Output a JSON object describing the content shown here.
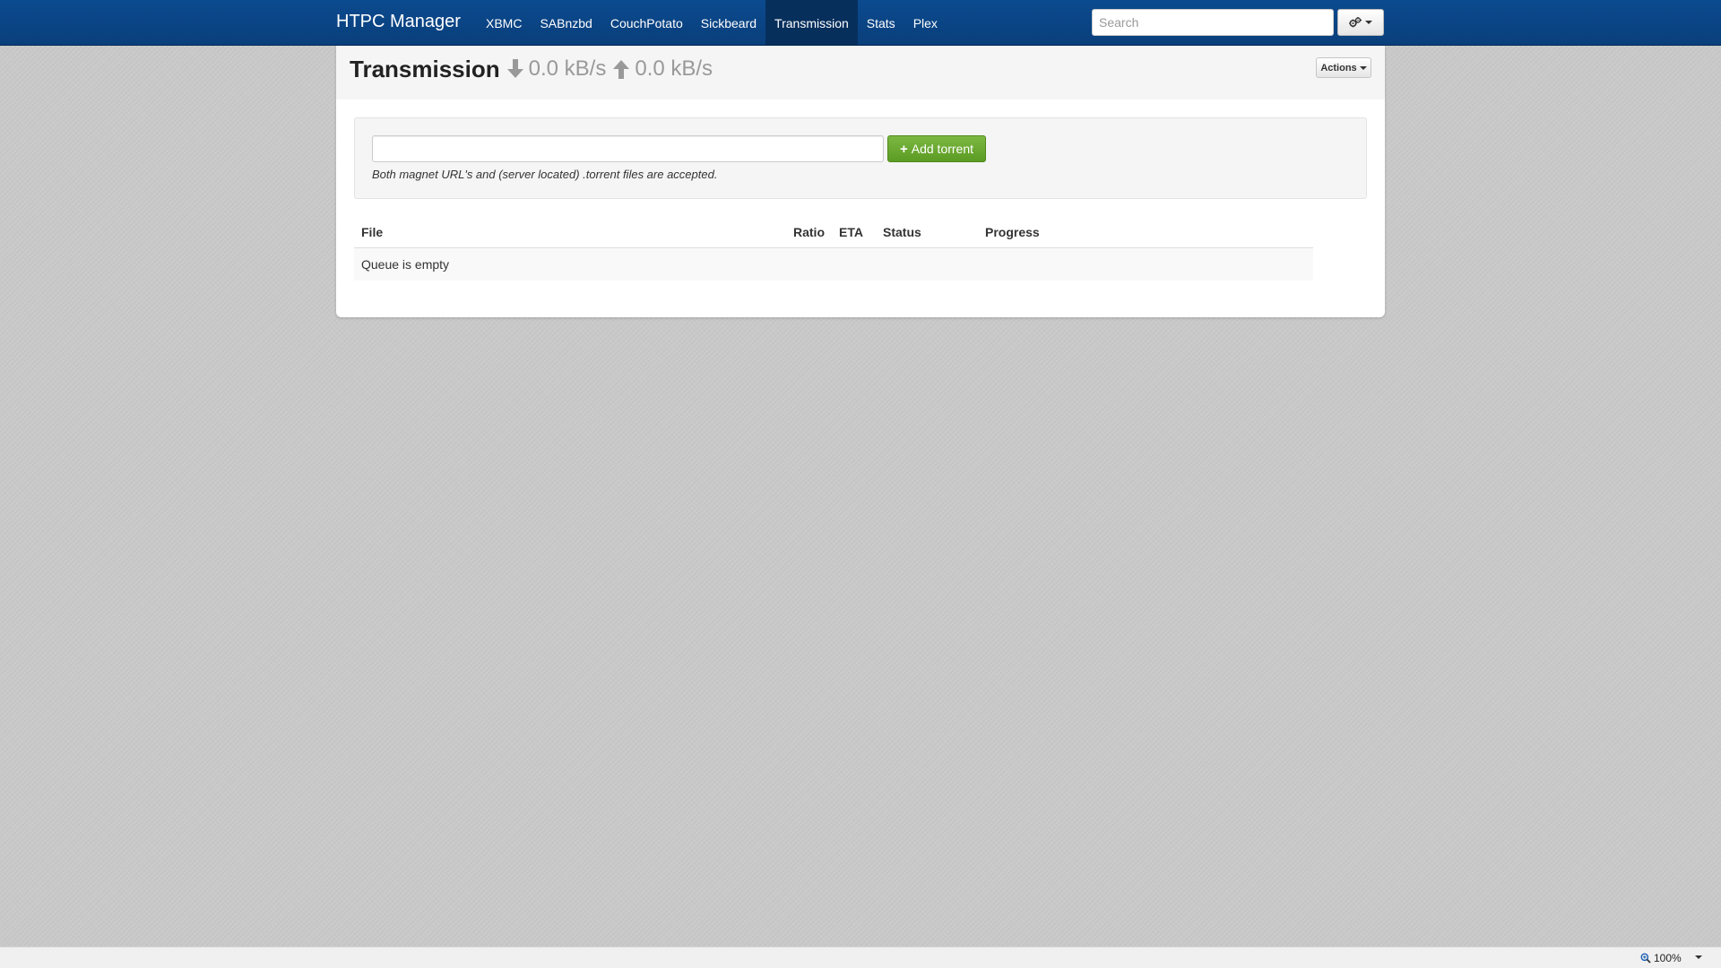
{
  "navbar": {
    "brand": "HTPC Manager",
    "items": [
      {
        "label": "XBMC",
        "active": false
      },
      {
        "label": "SABnzbd",
        "active": false
      },
      {
        "label": "CouchPotato",
        "active": false
      },
      {
        "label": "Sickbeard",
        "active": false
      },
      {
        "label": "Transmission",
        "active": true
      },
      {
        "label": "Stats",
        "active": false
      },
      {
        "label": "Plex",
        "active": false
      }
    ],
    "search_placeholder": "Search",
    "settings_icon": "gears-icon",
    "bg_color": "#0a4282"
  },
  "header": {
    "title": "Transmission",
    "download_speed": "0.0 kB/s",
    "upload_speed": "0.0 kB/s",
    "actions_label": "Actions"
  },
  "add_torrent": {
    "input_value": "",
    "button_label": "Add torrent",
    "help_text": "Both magnet URL's and (server located) .torrent files are accepted.",
    "button_color": "#6aa832"
  },
  "queue": {
    "columns": [
      "File",
      "Ratio",
      "ETA",
      "Status",
      "Progress"
    ],
    "empty_message": "Queue is empty"
  },
  "statusbar": {
    "zoom": "100%"
  }
}
